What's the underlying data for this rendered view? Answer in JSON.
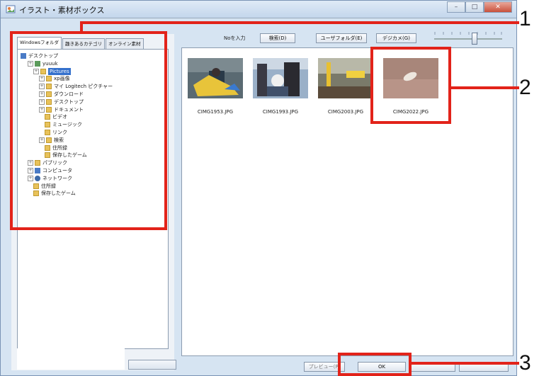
{
  "window": {
    "title": "イラスト・素材ボックス"
  },
  "tabs": [
    "Windowsフォルダ",
    "趣きあるカテゴリ",
    "オンライン素材"
  ],
  "tree": [
    {
      "label": "デスクトップ",
      "icon": "monitor-icon"
    },
    {
      "label": "yuuuk",
      "icon": "user-icon"
    },
    {
      "label": "Pictures",
      "icon": "folder-icon",
      "selected": true
    },
    {
      "label": "xp画像",
      "icon": "folder-icon"
    },
    {
      "label": "マイ Logitech ピクチャー",
      "icon": "folder-icon"
    },
    {
      "label": "ダウンロード",
      "icon": "folder-icon"
    },
    {
      "label": "デスクトップ",
      "icon": "folder-icon"
    },
    {
      "label": "ドキュメント",
      "icon": "folder-icon"
    },
    {
      "label": "ビデオ",
      "icon": "folder-icon"
    },
    {
      "label": "ミュージック",
      "icon": "folder-icon"
    },
    {
      "label": "リンク",
      "icon": "folder-icon"
    },
    {
      "label": "検索",
      "icon": "folder-icon"
    },
    {
      "label": "住所録",
      "icon": "folder-icon"
    },
    {
      "label": "保存したゲーム",
      "icon": "folder-icon"
    },
    {
      "label": "パブリック",
      "icon": "folder-icon"
    },
    {
      "label": "コンピュータ",
      "icon": "monitor-icon"
    },
    {
      "label": "ネットワーク",
      "icon": "network-icon"
    },
    {
      "label": "住所録",
      "icon": "folder-icon"
    },
    {
      "label": "保存したゲーム",
      "icon": "folder-icon"
    }
  ],
  "toolbar": {
    "number_label": "Noを入力",
    "search_button": "検索(D)",
    "user_folder_button": "ユーザフォルダ(E)",
    "digicam_button": "デジカメ(G)"
  },
  "thumbnails": [
    {
      "filename": "CIMG1953.JPG"
    },
    {
      "filename": "CIMG1993.JPG"
    },
    {
      "filename": "CIMG2003.JPG"
    },
    {
      "filename": "CIMG2022.JPG"
    }
  ],
  "bottom": {
    "preview_button": "プレビュー(P)",
    "ok_button": "OK"
  },
  "callouts": [
    "1",
    "2",
    "3"
  ],
  "colors": {
    "callout": "#e2231a",
    "selection": "#3470cc"
  }
}
